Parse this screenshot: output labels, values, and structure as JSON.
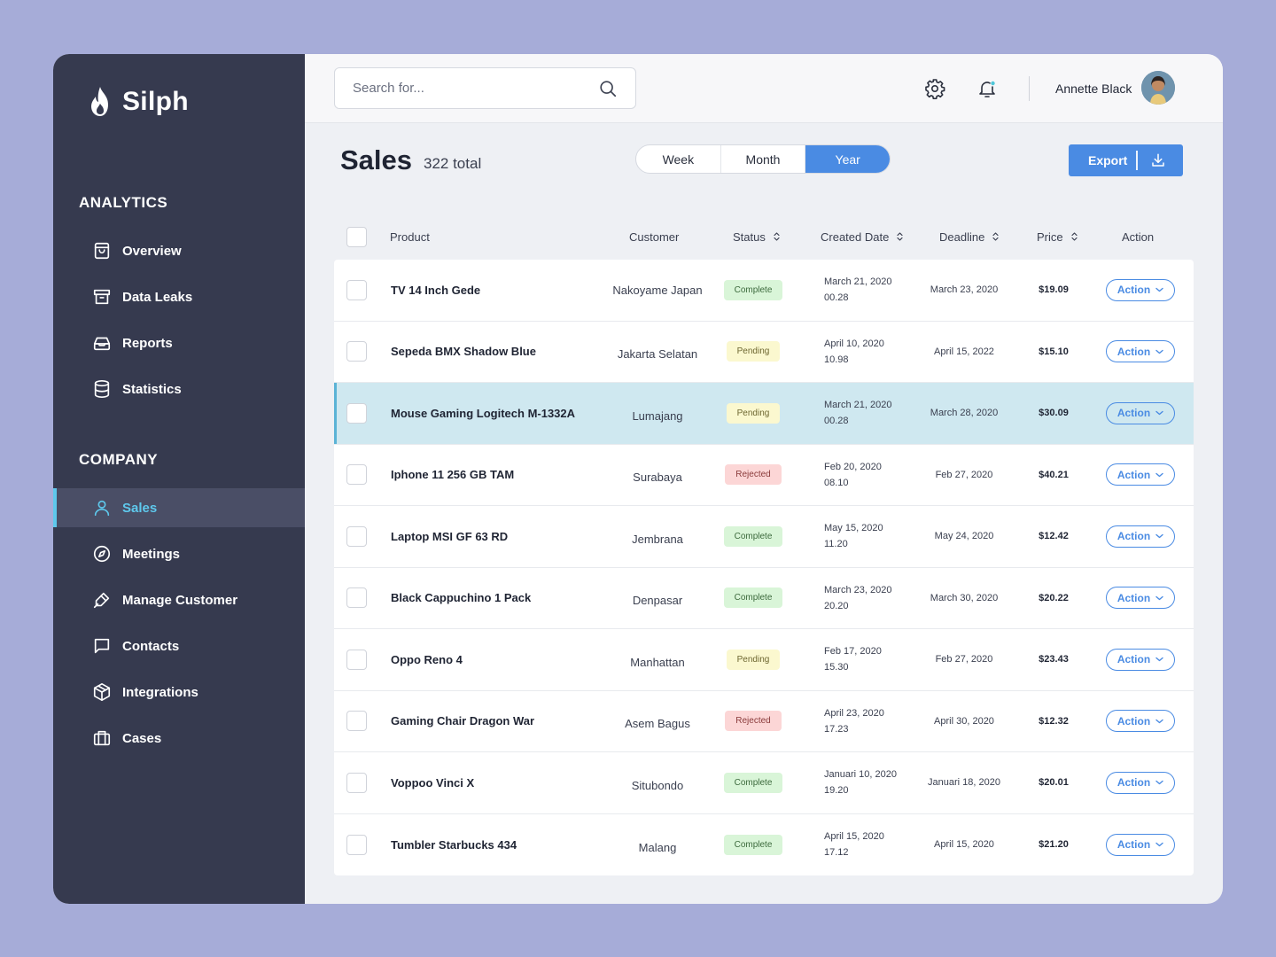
{
  "app": {
    "name": "Silph"
  },
  "sidebar": {
    "analytics_title": "ANALYTICS",
    "analytics_items": [
      {
        "label": "Overview",
        "icon": "bag-icon"
      },
      {
        "label": "Data Leaks",
        "icon": "archive-icon"
      },
      {
        "label": "Reports",
        "icon": "inbox-icon"
      },
      {
        "label": "Statistics",
        "icon": "database-icon"
      }
    ],
    "company_title": "COMPANY",
    "company_items": [
      {
        "label": "Sales",
        "icon": "user-icon",
        "active": true
      },
      {
        "label": "Meetings",
        "icon": "compass-icon"
      },
      {
        "label": "Manage Customer",
        "icon": "pen-tool-icon"
      },
      {
        "label": "Contacts",
        "icon": "message-icon"
      },
      {
        "label": "Integrations",
        "icon": "box-icon"
      },
      {
        "label": "Cases",
        "icon": "briefcase-icon"
      }
    ]
  },
  "topbar": {
    "search_placeholder": "Search for...",
    "user_name": "Annette Black"
  },
  "page": {
    "title": "Sales",
    "total": "322 total",
    "periods": [
      "Week",
      "Month",
      "Year"
    ],
    "active_period": "Year",
    "export_label": "Export"
  },
  "table": {
    "columns": [
      "Product",
      "Customer",
      "Status",
      "Created Date",
      "Deadline",
      "Price",
      "Action"
    ],
    "rows": [
      {
        "product": "TV 14 Inch Gede",
        "customer": "Nakoyame Japan",
        "status": "Complete",
        "created_date": "March 21, 2020",
        "created_time": "00.28",
        "deadline": "March 23, 2020",
        "price": "$19.09",
        "action": "Action"
      },
      {
        "product": "Sepeda BMX Shadow Blue",
        "customer": "Jakarta Selatan",
        "status": "Pending",
        "created_date": "April 10, 2020",
        "created_time": "10.98",
        "deadline": "April 15, 2022",
        "price": "$15.10",
        "action": "Action"
      },
      {
        "product": "Mouse Gaming Logitech M-1332A",
        "customer": "Lumajang",
        "status": "Pending",
        "created_date": "March 21, 2020",
        "created_time": "00.28",
        "deadline": "March 28, 2020",
        "price": "$30.09",
        "action": "Action",
        "highlighted": true
      },
      {
        "product": "Iphone 11 256 GB TAM",
        "customer": "Surabaya",
        "status": "Rejected",
        "created_date": "Feb 20, 2020",
        "created_time": "08.10",
        "deadline": "Feb 27, 2020",
        "price": "$40.21",
        "action": "Action"
      },
      {
        "product": "Laptop MSI GF 63 RD",
        "customer": "Jembrana",
        "status": "Complete",
        "created_date": "May 15, 2020",
        "created_time": "11.20",
        "deadline": "May 24, 2020",
        "price": "$12.42",
        "action": "Action"
      },
      {
        "product": "Black Cappuchino 1 Pack",
        "customer": "Denpasar",
        "status": "Complete",
        "created_date": "March 23, 2020",
        "created_time": "20.20",
        "deadline": "March 30, 2020",
        "price": "$20.22",
        "action": "Action"
      },
      {
        "product": "Oppo Reno 4",
        "customer": "Manhattan",
        "status": "Pending",
        "created_date": "Feb 17, 2020",
        "created_time": "15.30",
        "deadline": "Feb 27, 2020",
        "price": "$23.43",
        "action": "Action"
      },
      {
        "product": "Gaming Chair Dragon War",
        "customer": "Asem Bagus",
        "status": "Rejected",
        "created_date": "April 23, 2020",
        "created_time": "17.23",
        "deadline": "April 30, 2020",
        "price": "$12.32",
        "action": "Action"
      },
      {
        "product": "Voppoo Vinci X",
        "customer": "Situbondo",
        "status": "Complete",
        "created_date": "Januari 10, 2020",
        "created_time": "19.20",
        "deadline": "Januari 18, 2020",
        "price": "$20.01",
        "action": "Action"
      },
      {
        "product": "Tumbler Starbucks 434",
        "customer": "Malang",
        "status": "Complete",
        "created_date": "April 15, 2020",
        "created_time": "17.12",
        "deadline": "April 15, 2020",
        "price": "$21.20",
        "action": "Action"
      }
    ]
  },
  "colors": {
    "sidebar_bg": "#363a4f",
    "accent": "#4a8be3",
    "active_nav": "#5ec8ec",
    "highlight_row": "#cfe8f0"
  }
}
